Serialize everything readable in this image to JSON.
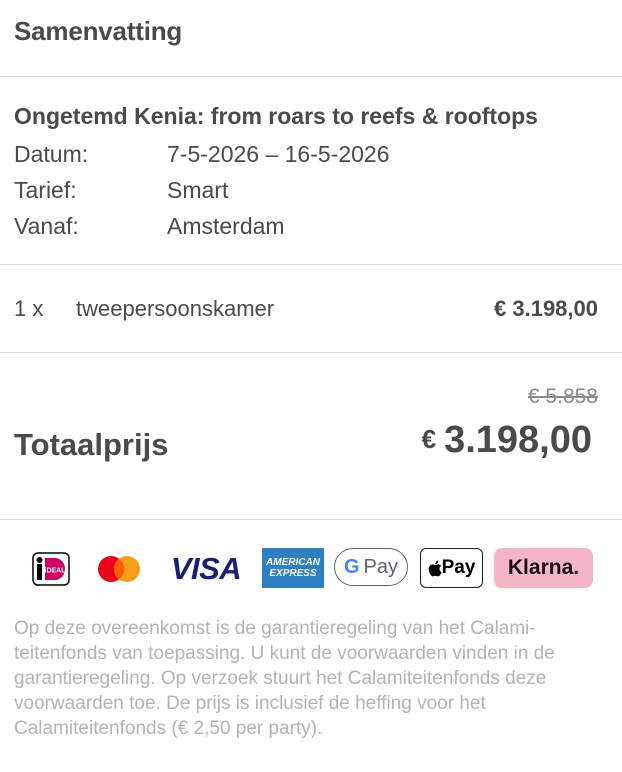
{
  "header": {
    "title": "Samenvatting"
  },
  "trip": {
    "title": "Ongetemd Kenia: from roars to reefs & rooftops",
    "rows": [
      {
        "label": "Datum:",
        "value": "7-5-2026 – 16-5-2026"
      },
      {
        "label": "Tarief:",
        "value": "Smart"
      },
      {
        "label": "Vanaf:",
        "value": "Amsterdam"
      }
    ]
  },
  "line_item": {
    "qty": "1 x",
    "description": "tweepersoonskamer",
    "price": "€ 3.198,00"
  },
  "total": {
    "old_price": "€ 5.858",
    "label": "Totaalprijs",
    "currency": "€",
    "amount": "3.198,00"
  },
  "payments": {
    "ideal": "iDEAL",
    "visa": "VISA",
    "amex_line1": "AMERICAN",
    "amex_line2": "EXPRESS",
    "gpay_g": "G",
    "gpay_pay": "Pay",
    "applepay": "Pay",
    "klarna": "Klarna.",
    "colors": {
      "mastercard_red": "#eb001b",
      "mastercard_yellow": "#f79e1b",
      "visa_blue": "#1a1f71",
      "amex_blue": "#2f7fc1",
      "klarna_pink": "#f4b6c7"
    }
  },
  "disclaimer": "Op deze overeenkomst is de garantieregeling van het Calami­teitenfonds van toepassing. U kunt de voorwaarden vinden in de garantieregeling. Op verzoek stuurt het Calamiteitenfonds deze voorwaarden toe. De prijs is inclusief de heffing voor het Calamiteitenfonds (€ 2,50 per party)."
}
